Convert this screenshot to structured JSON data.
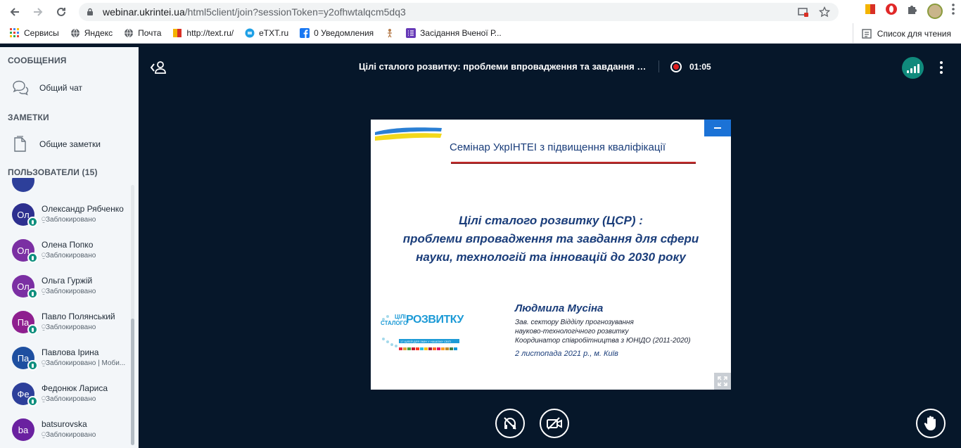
{
  "browser": {
    "url_host": "webinar.ukrintei.ua",
    "url_path": "/html5client/join?sessionToken=y2ofhwtalqcm5dq3",
    "bookmarks": [
      {
        "label": "Сервисы",
        "icon": "apps-grid-icon",
        "color": "#ea4335"
      },
      {
        "label": "Яндекс",
        "icon": "globe-icon",
        "color": "#5f6368"
      },
      {
        "label": "Почта",
        "icon": "globe-icon",
        "color": "#5f6368"
      },
      {
        "label": "http://text.ru/",
        "icon": "textru-flag-icon",
        "color": "#f4b400"
      },
      {
        "label": "eTXT.ru",
        "icon": "etxt-icon",
        "color": "#1ea0e6"
      },
      {
        "label": "0 Уведомления",
        "icon": "facebook-icon",
        "color": "#1877f2"
      },
      {
        "label": "",
        "icon": "figure-icon",
        "color": "#b57b4a"
      },
      {
        "label": "Засідання Вченої Р...",
        "icon": "forms-icon",
        "color": "#673ab7"
      }
    ],
    "reading_list_label": "Список для чтения"
  },
  "sidebar": {
    "messages_title": "СООБЩЕНИЯ",
    "public_chat": "Общий чат",
    "notes_title": "ЗАМЕТКИ",
    "shared_notes": "Общие заметки",
    "users_title": "ПОЛЬЗОВАТЕЛИ (15)",
    "users": [
      {
        "initials": "Ол",
        "name": "Олександр Рябченко",
        "status": "Заблокировано",
        "color": "#2d2f8f",
        "mic": true
      },
      {
        "initials": "Ол",
        "name": "Олена Попко",
        "status": "Заблокировано",
        "color": "#7b2fa3",
        "mic": true
      },
      {
        "initials": "Ол",
        "name": "Ольга Гуржій",
        "status": "Заблокировано",
        "color": "#7b2fa3",
        "mic": true
      },
      {
        "initials": "Па",
        "name": "Павло Полянський",
        "status": "Заблокировано",
        "color": "#8e1f8f",
        "mic": true
      },
      {
        "initials": "Па",
        "name": "Павлова Ірина",
        "status": "Заблокировано | Моби...",
        "color": "#1e4fa0",
        "mic": true
      },
      {
        "initials": "Фе",
        "name": "Федонюк Лариса",
        "status": "Заблокировано",
        "color": "#2d3f9a",
        "mic": true
      },
      {
        "initials": "ba",
        "name": "batsurovska",
        "status": "Заблокировано",
        "color": "#6a21a0",
        "mic": false
      }
    ]
  },
  "main": {
    "title": "Цілі сталого розвитку: проблеми впровадження та завдання д...",
    "timer": "01:05"
  },
  "slide": {
    "seminar": "Семінар УкрІНТЕІ з підвищення кваліфікації",
    "title_lines": [
      "Цілі сталого розвитку (ЦСР) :",
      "проблеми впровадження та завдання для сфери",
      "науки, технологій та інновацій до 2030 року"
    ],
    "author": "Людмила Мусіна",
    "role_lines": [
      "Зав. сектору Відділу прогнозування",
      "науково-технологічного розвитку",
      "Координатор співробітництва з ЮНІДО (2011-2020)"
    ],
    "date": "2 листопада 2021 р., м. Київ",
    "logo_small": "ЦІЛІ",
    "logo_small2": "СТАЛОГО",
    "logo_big": "РОЗВИТКУ",
    "logo_sub": "17 ЦІЛЕЙ ДЛЯ ЗМІН У НАШОМУ СВІТІ"
  },
  "colors": {
    "page_bg": "#06172a",
    "sidebar_bg": "#f3f6f9",
    "accent_teal": "#108a7c",
    "record_red": "#e01e1e",
    "slide_blue": "#1a3d7a"
  }
}
